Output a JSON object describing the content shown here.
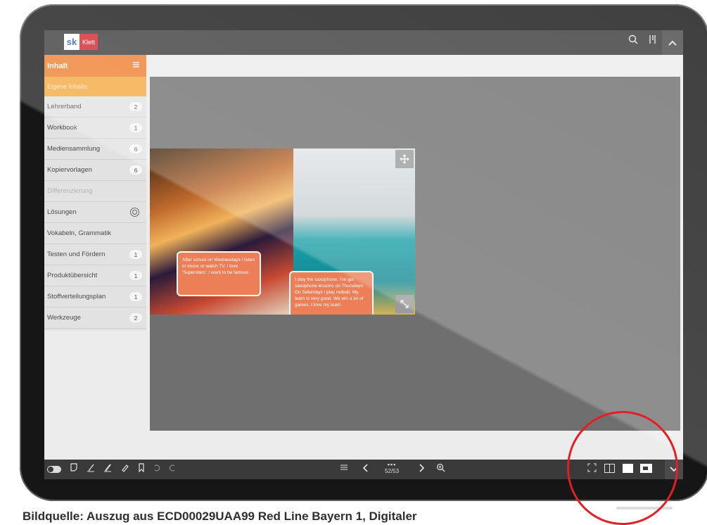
{
  "app": {
    "brand": "Klett",
    "brand_mark": "sk"
  },
  "topbar": {
    "icons": [
      "search-icon",
      "ruler-icon",
      "chevron-up-icon"
    ]
  },
  "sidebar": {
    "title": "Inhalt",
    "subtitle": "Eigene Inhalte",
    "items": [
      {
        "label": "Lehrerband",
        "count": "2"
      },
      {
        "label": "Workbook",
        "count": "1"
      },
      {
        "label": "Mediensammlung",
        "count": "6"
      },
      {
        "label": "Kopiervorlagen",
        "count": "6"
      },
      {
        "label": "Differenzierung",
        "count": ""
      },
      {
        "label": "Lösungen",
        "count": ""
      },
      {
        "label": "Vokabeln, Grammatik",
        "count": ""
      },
      {
        "label": "Testen und Fördern",
        "count": "1"
      },
      {
        "label": "Produktübersicht",
        "count": "1"
      },
      {
        "label": "Stoffverteilungsplan",
        "count": "1"
      },
      {
        "label": "Werkzeuge",
        "count": "2"
      }
    ]
  },
  "content": {
    "bubble_left": "After school on Wednesdays I listen to music or watch TV. I love 'Superstars'. I want to be famous.",
    "bubble_right": "I play the saxophone. I've got saxophone lessons on Thursdays. On Saturdays I play netball. My team is very good. We win a lot of games. I love my team."
  },
  "bottombar": {
    "page": "52/53",
    "tools": [
      "toggle-icon",
      "note-icon",
      "pen-icon",
      "marker-icon",
      "eraser-icon",
      "bookmark-icon",
      "undo-icon",
      "redo-icon"
    ],
    "nav": [
      "list-icon",
      "prev-icon",
      "pages-icon",
      "next-icon",
      "zoom-icon"
    ],
    "views": [
      "fullscreen-icon",
      "double-page-icon",
      "single-page-icon",
      "fit-icon",
      "chevron-down-icon"
    ]
  },
  "caption": "Bildquelle: Auszug aus ECD00029UAA99 Red Line Bayern 1, Digitaler",
  "colors": {
    "accent": "#ee7d2f",
    "accent_light": "#f5a83e",
    "brand_red": "#d4232b",
    "highlight": "#e31e24"
  }
}
